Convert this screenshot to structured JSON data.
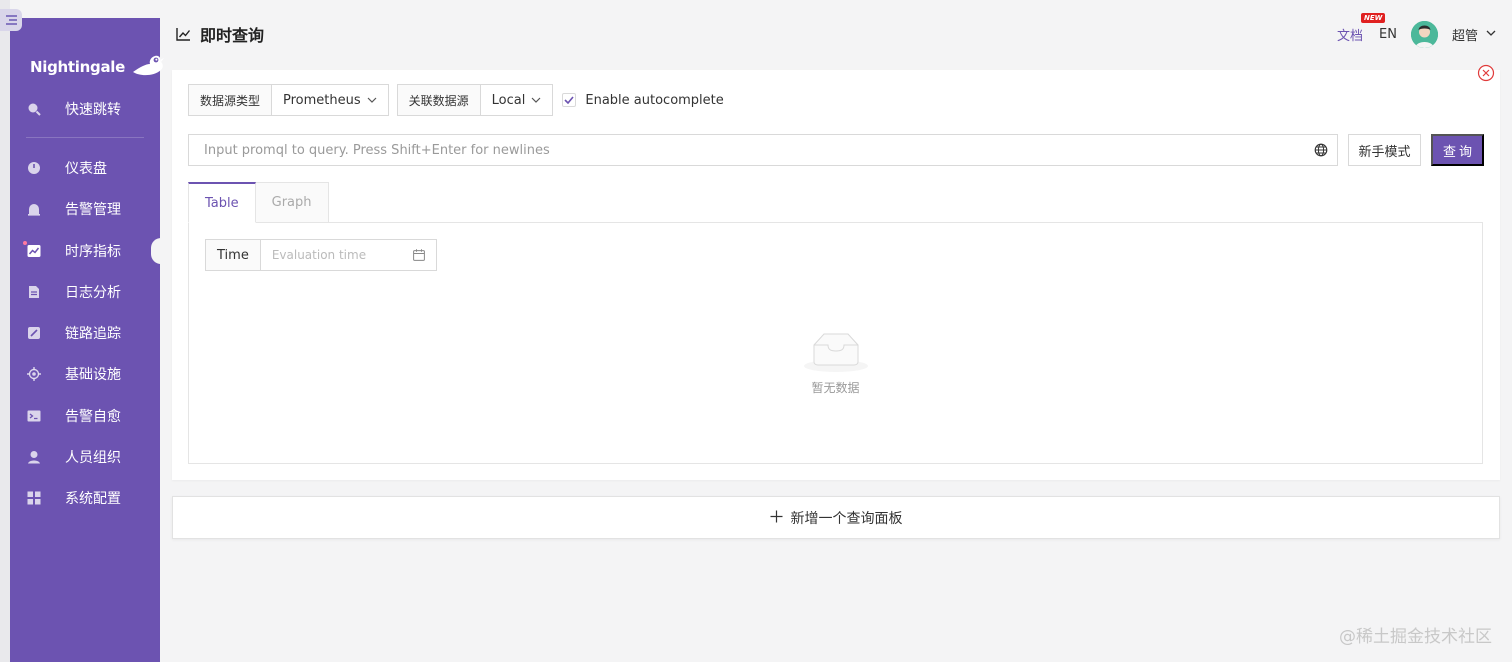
{
  "brand": {
    "name": "Nightingale"
  },
  "sidebar": {
    "top_item": {
      "label": "快速跳转",
      "icon": "search-icon"
    },
    "items": [
      {
        "label": "仪表盘",
        "icon": "dashboard-icon"
      },
      {
        "label": "告警管理",
        "icon": "alarm-bell-icon"
      },
      {
        "label": "时序指标",
        "icon": "line-chart-icon",
        "active": true
      },
      {
        "label": "日志分析",
        "icon": "document-icon"
      },
      {
        "label": "链路追踪",
        "icon": "trace-icon"
      },
      {
        "label": "基础设施",
        "icon": "target-icon"
      },
      {
        "label": "告警自愈",
        "icon": "terminal-icon"
      },
      {
        "label": "人员组织",
        "icon": "user-icon"
      },
      {
        "label": "系统配置",
        "icon": "settings-grid-icon"
      }
    ]
  },
  "header": {
    "title": "即时查询",
    "title_icon": "line-chart-icon",
    "doc_label": "文档",
    "new_badge": "NEW",
    "lang": "EN",
    "username": "超管"
  },
  "query": {
    "datasource_type_label": "数据源类型",
    "datasource_type_value": "Prometheus",
    "datasource_label": "关联数据源",
    "datasource_value": "Local",
    "autocomplete_label": "Enable autocomplete",
    "autocomplete_checked": true,
    "input_placeholder": "Input promql to query. Press Shift+Enter for newlines",
    "input_value": "",
    "novice_button": "新手模式",
    "query_button": "查询",
    "tabs": [
      {
        "label": "Table",
        "active": true
      },
      {
        "label": "Graph",
        "active": false
      }
    ],
    "time_label": "Time",
    "time_placeholder": "Evaluation time",
    "empty_text": "暂无数据"
  },
  "add_panel": {
    "label": "新增一个查询面板"
  },
  "watermark": "@稀土掘金技术社区",
  "colors": {
    "primary": "#6c53b1",
    "background": "#f4f4f5",
    "danger": "#e02020"
  }
}
